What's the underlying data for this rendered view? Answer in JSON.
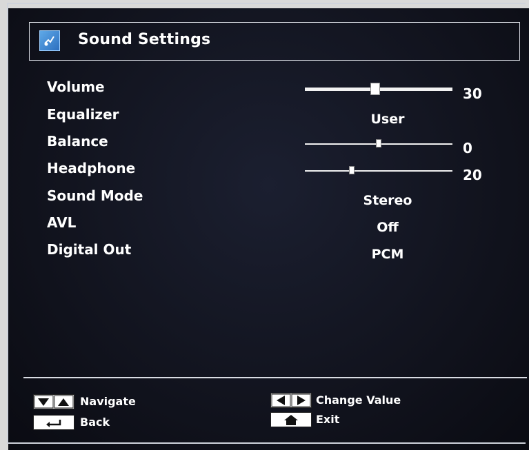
{
  "header": {
    "title": "Sound Settings",
    "icon": "sound-settings-icon"
  },
  "menu": {
    "volume": {
      "label": "Volume",
      "value": "30",
      "level": 30,
      "max": 63
    },
    "equalizer": {
      "label": "Equalizer",
      "value": "User"
    },
    "balance": {
      "label": "Balance",
      "value": "0",
      "level": 0,
      "min": -32,
      "max": 32
    },
    "headphone": {
      "label": "Headphone",
      "value": "20",
      "level": 20,
      "max": 63
    },
    "sound_mode": {
      "label": "Sound Mode",
      "value": "Stereo"
    },
    "avl": {
      "label": "AVL",
      "value": "Off"
    },
    "digital_out": {
      "label": "Digital Out",
      "value": "PCM"
    }
  },
  "footer": {
    "navigate": "Navigate",
    "back": "Back",
    "change_value": "Change Value",
    "exit": "Exit"
  },
  "colors": {
    "text": "#ffffff",
    "background": "#12141f",
    "frame": "#d8dbe2"
  }
}
